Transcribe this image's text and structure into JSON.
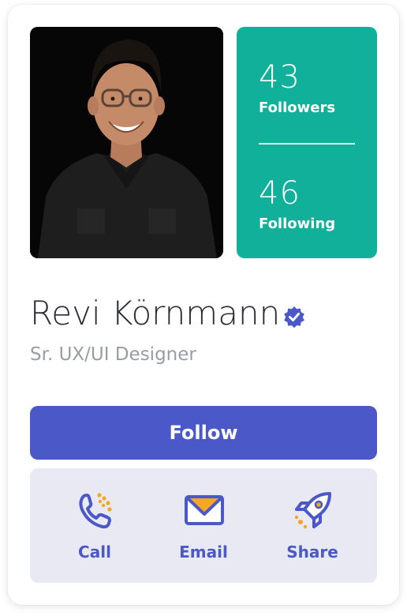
{
  "profile": {
    "name": "Revi Körnmann",
    "role": "Sr. UX/UI Designer",
    "verified": true
  },
  "stats": {
    "followers_count": "43",
    "followers_label": "Followers",
    "following_count": "46",
    "following_label": "Following"
  },
  "follow_button": {
    "label": "Follow"
  },
  "actions": [
    {
      "label": "Call",
      "icon": "phone-icon"
    },
    {
      "label": "Email",
      "icon": "envelope-icon"
    },
    {
      "label": "Share",
      "icon": "rocket-icon"
    }
  ],
  "colors": {
    "accent": "#4a58c8",
    "stats_bg": "#10b09a",
    "actions_bg": "#e8e9f3",
    "icon_accent": "#f5a623"
  }
}
